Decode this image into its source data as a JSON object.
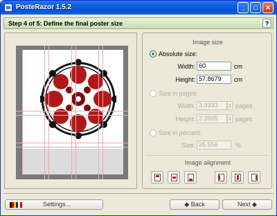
{
  "window": {
    "title": "PosteRazor 1.5.2",
    "controls": {
      "minimize": "_",
      "maximize": "□",
      "close": "✕"
    }
  },
  "step": {
    "title": "Step 4 of 5: Define the final poster size",
    "help_label": "?"
  },
  "image_size": {
    "section_title": "Image size",
    "absolute": {
      "label": "Absolute size:",
      "selected": true,
      "width_label": "Width:",
      "width_value": "60",
      "width_unit": "cm",
      "height_label": "Height:",
      "height_value": "57.8679",
      "height_unit": "cm"
    },
    "pages": {
      "label": "Size in pages:",
      "selected": false,
      "width_label": "Width:",
      "width_value": "3.9333",
      "width_unit": "pages",
      "height_label": "Height:",
      "height_value": "2.3995",
      "height_unit": "pages"
    },
    "percent": {
      "label": "Size in percent:",
      "selected": false,
      "size_label": "Size:",
      "size_value": "35.556",
      "size_unit": "%"
    }
  },
  "image_alignment": {
    "section_title": "Image alignment",
    "options": [
      "top",
      "center",
      "bottom",
      "left",
      "middle",
      "right"
    ],
    "selected": "middle"
  },
  "footer": {
    "settings_label": "Settings...",
    "back_label": "◆ Back",
    "next_label": "Next ◆"
  },
  "colors": {
    "title_bar": "#0453d6",
    "step_bar": "#c9ddb2",
    "grid_lines": "#f0a8a8",
    "ornament_red": "#b01818",
    "ornament_black": "#111111"
  }
}
